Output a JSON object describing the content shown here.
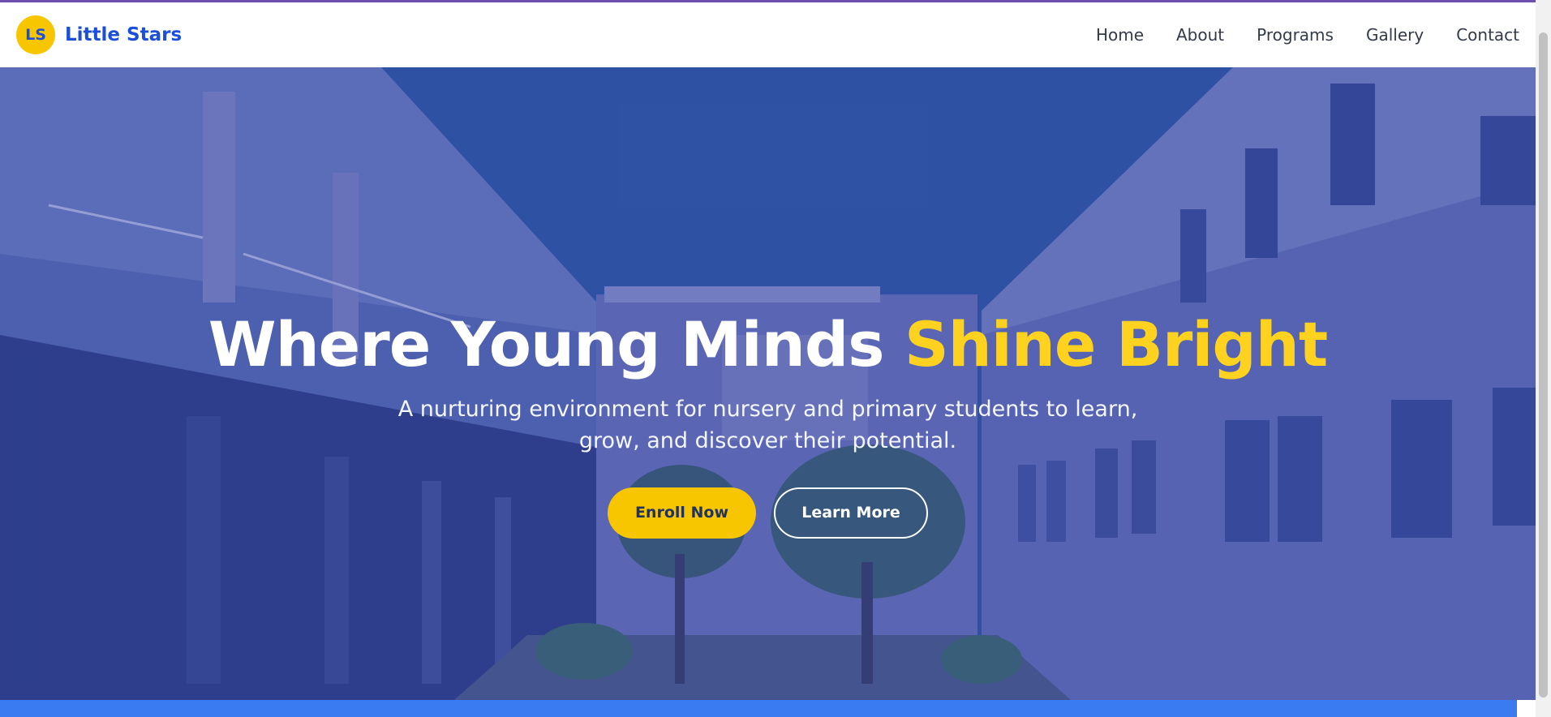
{
  "brand": {
    "logo_text": "LS",
    "name": "Little Stars"
  },
  "nav": {
    "items": [
      {
        "label": "Home"
      },
      {
        "label": "About"
      },
      {
        "label": "Programs"
      },
      {
        "label": "Gallery"
      },
      {
        "label": "Contact"
      }
    ]
  },
  "hero": {
    "title_main": "Where Young Minds",
    "title_accent": "Shine Bright",
    "subtitle": "A nurturing environment for nursery and primary students to learn, grow, and discover their potential.",
    "primary_button": "Enroll Now",
    "secondary_button": "Learn More"
  },
  "colors": {
    "brand_blue": "#1b4fd8",
    "accent_yellow": "#f7c600",
    "title_accent": "#ffd21f",
    "hero_overlay": "#3a5ea8"
  }
}
